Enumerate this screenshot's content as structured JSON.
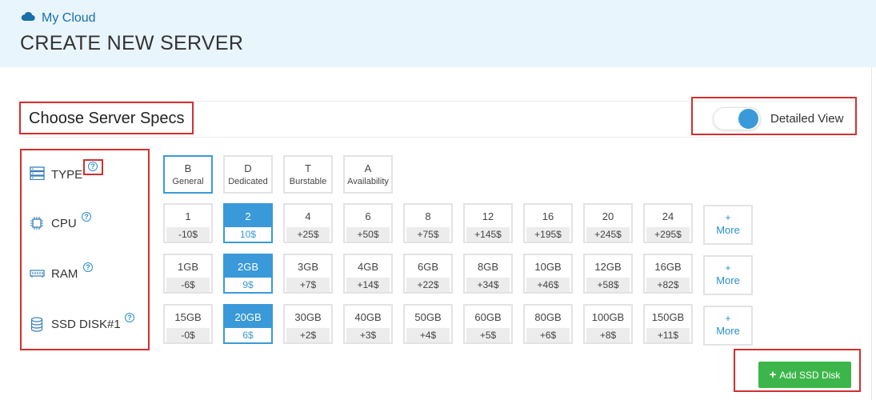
{
  "breadcrumb": {
    "icon": "cloud-icon",
    "label": "My Cloud"
  },
  "page": {
    "title": "CREATE NEW SERVER"
  },
  "section": {
    "title": "Choose Server Specs"
  },
  "view_toggle": {
    "label": "Detailed View",
    "on": true
  },
  "row_labels": {
    "type": "TYPE",
    "cpu": "CPU",
    "ram": "RAM",
    "disk": "SSD DISK#1"
  },
  "types": [
    {
      "letter": "B",
      "name": "General",
      "selected": true
    },
    {
      "letter": "D",
      "name": "Dedicated",
      "selected": false
    },
    {
      "letter": "T",
      "name": "Burstable",
      "selected": false
    },
    {
      "letter": "A",
      "name": "Availability",
      "selected": false
    }
  ],
  "cpu": [
    {
      "value": "1",
      "price": "-10$"
    },
    {
      "value": "2",
      "price": "10$",
      "selected": true
    },
    {
      "value": "4",
      "price": "+25$"
    },
    {
      "value": "6",
      "price": "+50$"
    },
    {
      "value": "8",
      "price": "+75$"
    },
    {
      "value": "12",
      "price": "+145$"
    },
    {
      "value": "16",
      "price": "+195$"
    },
    {
      "value": "20",
      "price": "+245$"
    },
    {
      "value": "24",
      "price": "+295$"
    }
  ],
  "ram": [
    {
      "value": "1GB",
      "price": "-6$"
    },
    {
      "value": "2GB",
      "price": "9$",
      "selected": true
    },
    {
      "value": "3GB",
      "price": "+7$"
    },
    {
      "value": "4GB",
      "price": "+14$"
    },
    {
      "value": "6GB",
      "price": "+22$"
    },
    {
      "value": "8GB",
      "price": "+34$"
    },
    {
      "value": "10GB",
      "price": "+46$"
    },
    {
      "value": "12GB",
      "price": "+58$"
    },
    {
      "value": "16GB",
      "price": "+82$"
    }
  ],
  "disk": [
    {
      "value": "15GB",
      "price": "-0$"
    },
    {
      "value": "20GB",
      "price": "6$",
      "selected": true
    },
    {
      "value": "30GB",
      "price": "+2$"
    },
    {
      "value": "40GB",
      "price": "+3$"
    },
    {
      "value": "50GB",
      "price": "+4$"
    },
    {
      "value": "60GB",
      "price": "+5$"
    },
    {
      "value": "80GB",
      "price": "+6$"
    },
    {
      "value": "100GB",
      "price": "+8$"
    },
    {
      "value": "150GB",
      "price": "+11$"
    }
  ],
  "more": {
    "plus": "+",
    "label": "More"
  },
  "help_icon_glyph": "?",
  "add_disk": {
    "label": "Add SSD Disk",
    "plus": "+"
  },
  "colors": {
    "accent": "#3a9ad9",
    "success": "#3cb64a",
    "highlight_box": "#d32f2f",
    "header_bg": "#e9f5fc"
  }
}
